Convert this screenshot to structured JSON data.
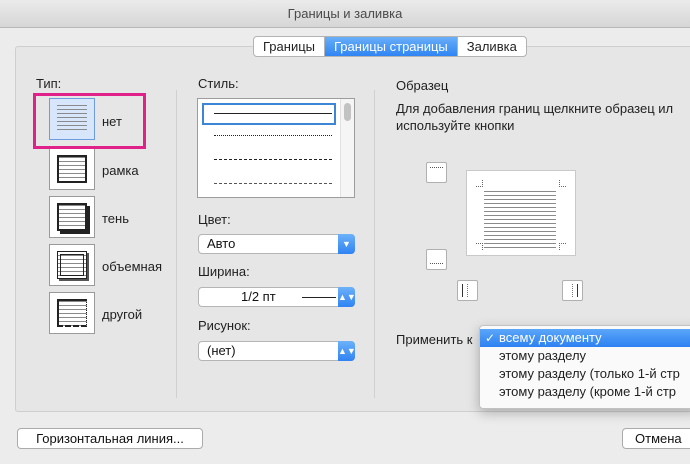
{
  "window": {
    "title": "Границы и заливка"
  },
  "tabs": [
    {
      "label": "Границы"
    },
    {
      "label": "Границы страницы"
    },
    {
      "label": "Заливка"
    }
  ],
  "type_section": {
    "label": "Тип:",
    "items": [
      {
        "label": "нет"
      },
      {
        "label": "рамка"
      },
      {
        "label": "тень"
      },
      {
        "label": "объемная"
      },
      {
        "label": "другой"
      }
    ]
  },
  "style_section": {
    "label": "Стиль:",
    "color_label": "Цвет:",
    "color_value": "Авто",
    "width_label": "Ширина:",
    "width_value": "1/2 пт",
    "art_label": "Рисунок:",
    "art_value": "(нет)"
  },
  "preview": {
    "label": "Образец",
    "hint_line1": "Для добавления границ щелкните образец ил",
    "hint_line2": "используйте кнопки"
  },
  "apply_to": {
    "label": "Применить к",
    "options": [
      {
        "label": "всему документу",
        "selected": true
      },
      {
        "label": "этому разделу"
      },
      {
        "label": "этому разделу (только 1-й стр"
      },
      {
        "label": "этому разделу (кроме 1-й стр"
      }
    ]
  },
  "buttons": {
    "horizontal_line": "Горизонтальная линия...",
    "cancel": "Отмена"
  },
  "colors": {
    "accent": "#2f85f3",
    "highlight": "#e0218a"
  }
}
